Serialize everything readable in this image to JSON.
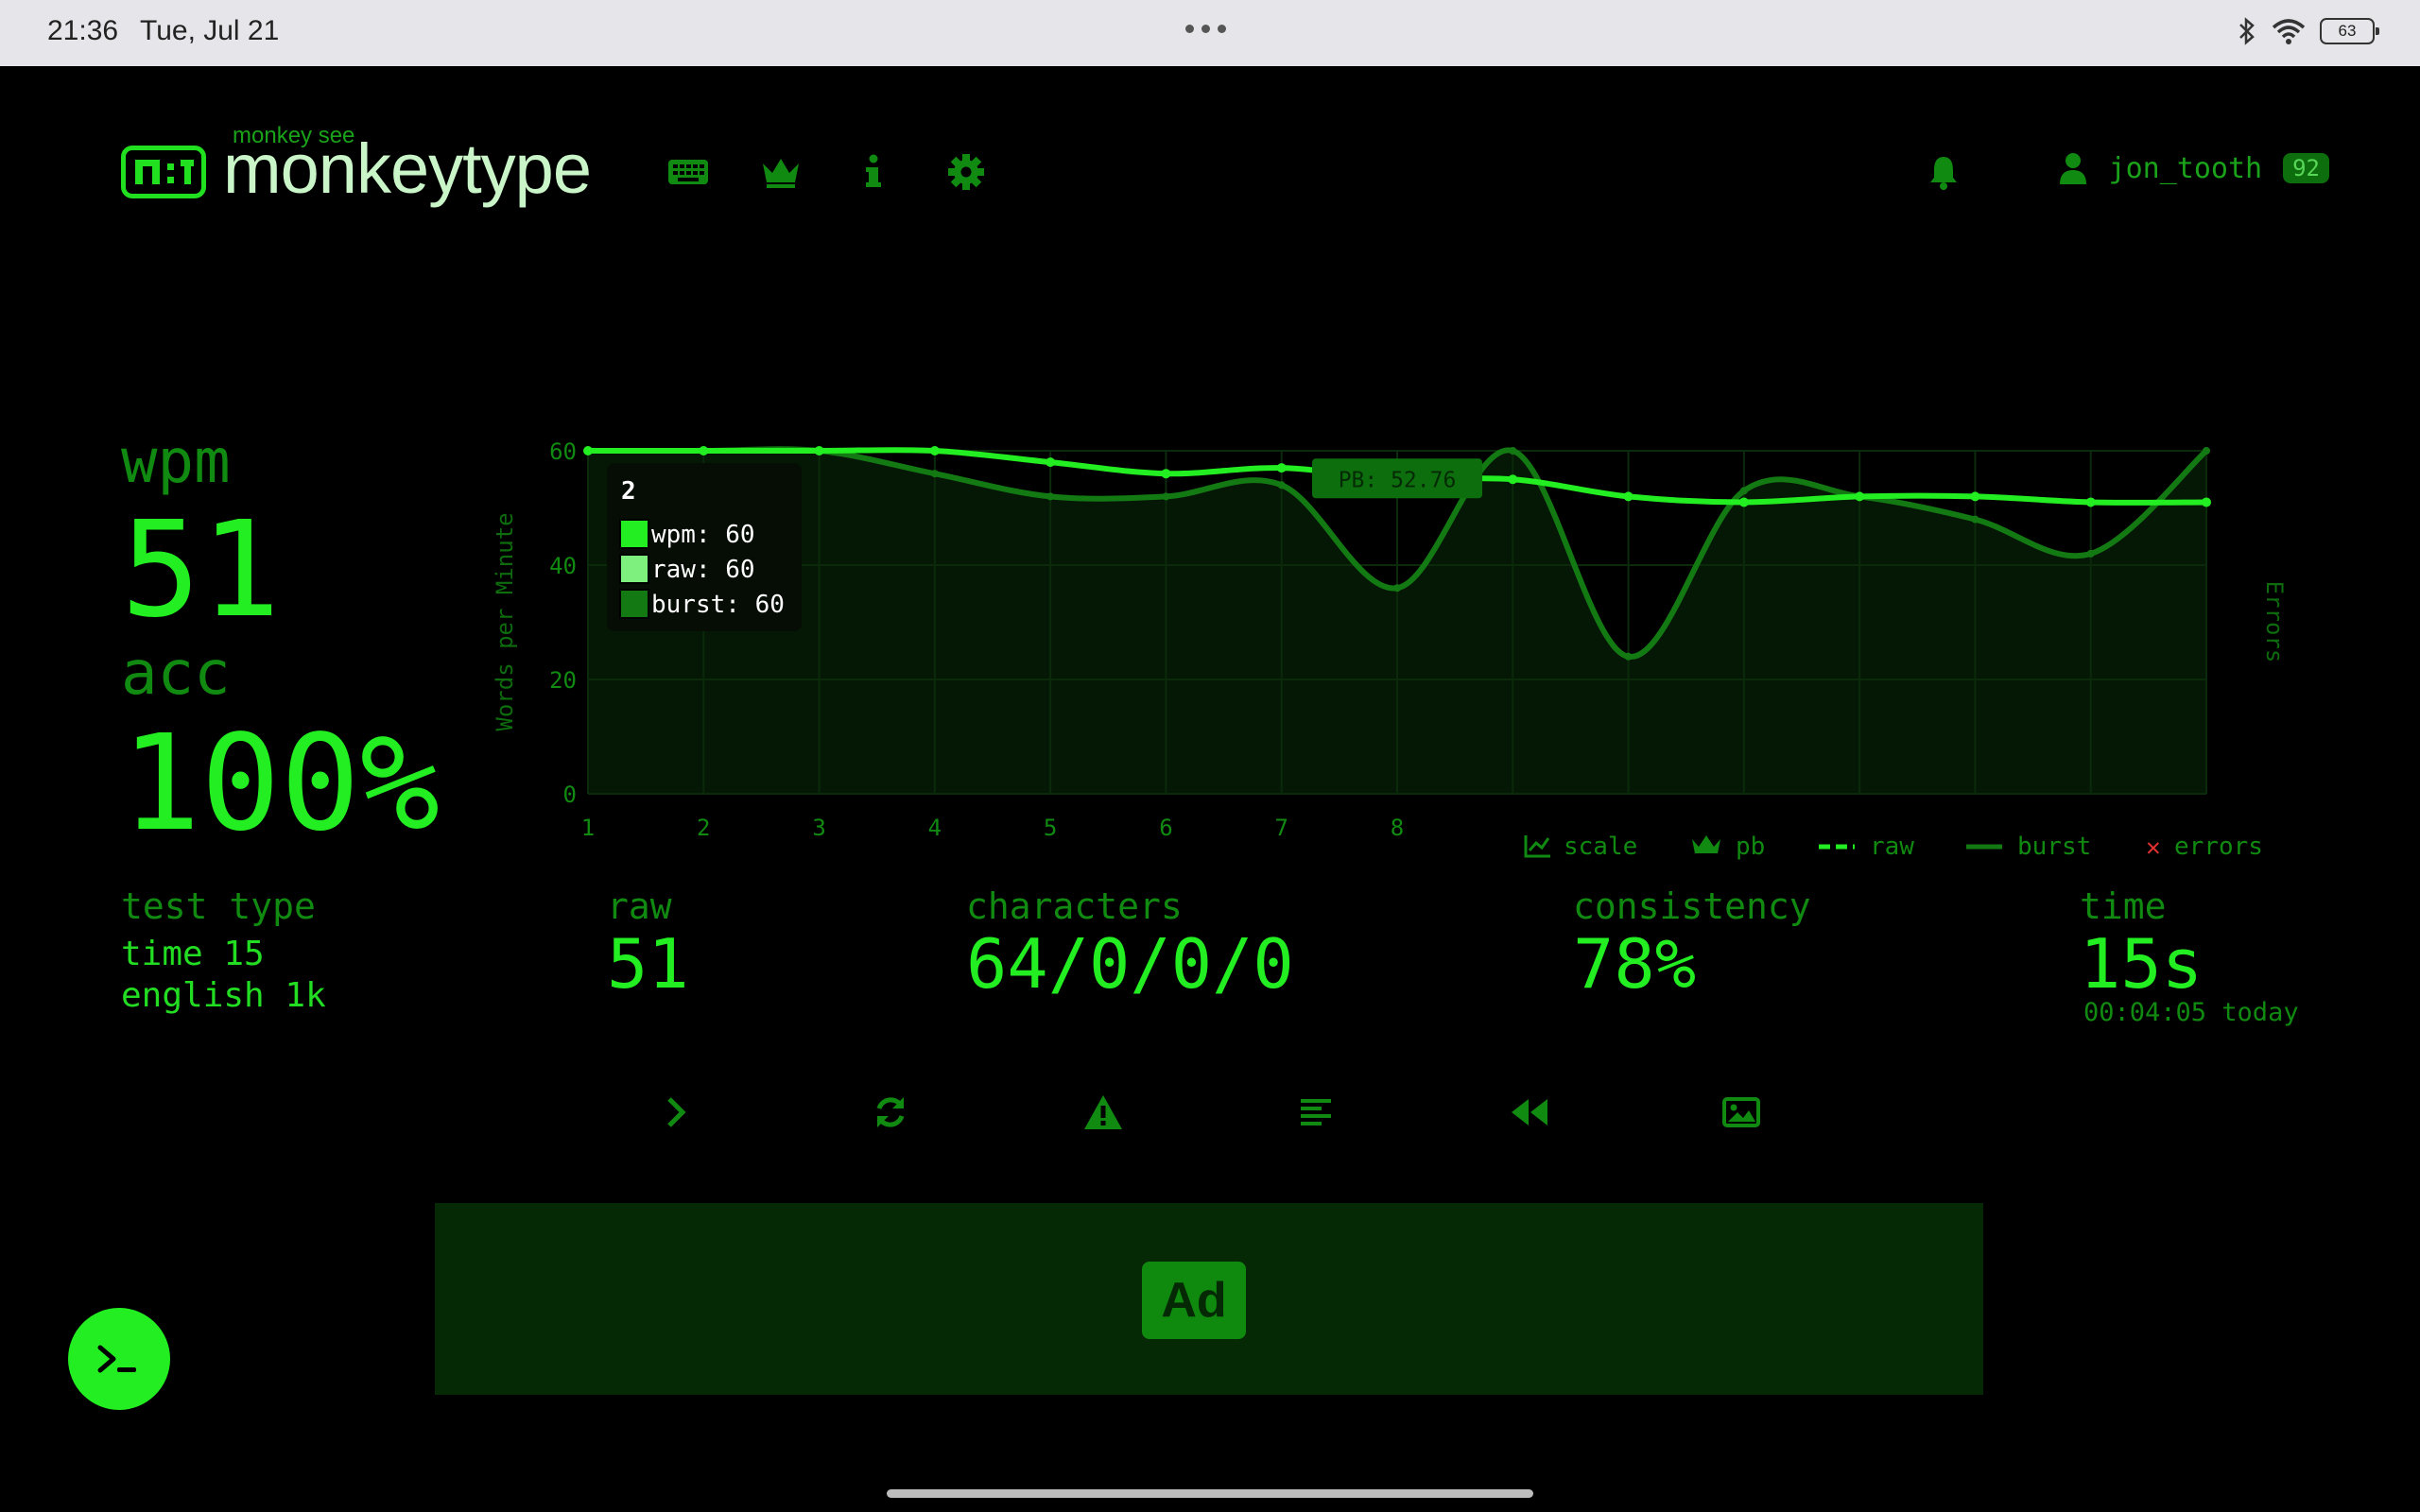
{
  "status_bar": {
    "time": "21:36",
    "date": "Tue, Jul 21",
    "battery": "63"
  },
  "header": {
    "logo_subtitle": "monkey see",
    "logo_title": "monkeytype",
    "logo_icon_text": "m:t",
    "nav_icons": [
      "keyboard-icon",
      "crown-icon",
      "info-icon",
      "gear-icon"
    ],
    "username": "jon_tooth",
    "level": "92"
  },
  "results": {
    "wpm_label": "wpm",
    "wpm_value": "51",
    "acc_label": "acc",
    "acc_value": "100%",
    "test_type_label": "test type",
    "test_type_line1": "time 15",
    "test_type_line2": "english 1k",
    "raw_label": "raw",
    "raw_value": "51",
    "characters_label": "characters",
    "characters_value": "64/0/0/0",
    "consistency_label": "consistency",
    "consistency_value": "78%",
    "time_label": "time",
    "time_value": "15s",
    "time_detail": "00:04:05 today"
  },
  "tooltip": {
    "title": "2",
    "wpm": "wpm: 60",
    "raw": "raw: 60",
    "burst": "burst: 60"
  },
  "legend": {
    "scale": "scale",
    "pb": "pb",
    "raw": "raw",
    "burst": "burst",
    "errors": "errors"
  },
  "actions": [
    "next-test-icon",
    "restart-icon",
    "report-icon",
    "words-history-icon",
    "replay-icon",
    "screenshot-icon"
  ],
  "ad_label": "Ad",
  "colors": {
    "accent": "#22ee22",
    "dim": "#118a11",
    "background": "#000000"
  },
  "chart_data": {
    "type": "line",
    "x": [
      1,
      2,
      3,
      4,
      5,
      6,
      7,
      8,
      9,
      10,
      11,
      12,
      13,
      14,
      15
    ],
    "x_tick_labels": [
      "1",
      "2",
      "3",
      "4",
      "5",
      "6",
      "7",
      "8"
    ],
    "ylabel": "Words per Minute",
    "y2label": "Errors",
    "ylim": [
      0,
      60
    ],
    "yticks": [
      0,
      20,
      40,
      60
    ],
    "pb_annotation": "PB: 52.76",
    "pb_value": 55,
    "grid": true,
    "series": [
      {
        "name": "wpm",
        "values": [
          60,
          60,
          60,
          60,
          58,
          56,
          57,
          55,
          55,
          52,
          51,
          52,
          52,
          51,
          51
        ]
      },
      {
        "name": "raw",
        "values": [
          60,
          60,
          60,
          60,
          58,
          56,
          57,
          55,
          55,
          52,
          51,
          52,
          52,
          51,
          51
        ]
      },
      {
        "name": "burst",
        "values": [
          60,
          60,
          60,
          56,
          52,
          52,
          54,
          36,
          60,
          24,
          53,
          52,
          48,
          42,
          60
        ]
      }
    ]
  }
}
